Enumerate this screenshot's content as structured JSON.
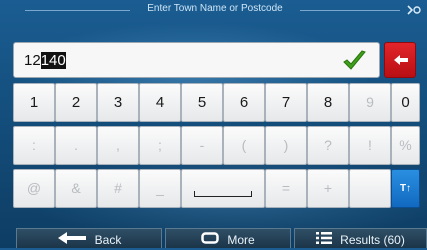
{
  "header": {
    "title": "Enter Town Name or Postcode",
    "status_icon": "gps-signal-icon"
  },
  "input": {
    "value_prefix": "12",
    "value_selected": "140"
  },
  "keyboard": {
    "row1": [
      "1",
      "2",
      "3",
      "4",
      "5",
      "6",
      "7",
      "8",
      "9",
      "0"
    ],
    "row2": [
      ":",
      ".",
      ",",
      ";",
      "-",
      "(",
      ")",
      "?",
      "!",
      "%"
    ],
    "row3": [
      "@",
      "&",
      "#",
      "_",
      "",
      "=",
      "+",
      ""
    ],
    "shift_label": "T↑"
  },
  "bottom": {
    "back_label": "Back",
    "more_label": "More",
    "results_label": "Results (60)"
  },
  "colors": {
    "accent_red": "#d51b20",
    "accent_blue": "#1a7fd6",
    "check_green": "#3fa01a"
  }
}
